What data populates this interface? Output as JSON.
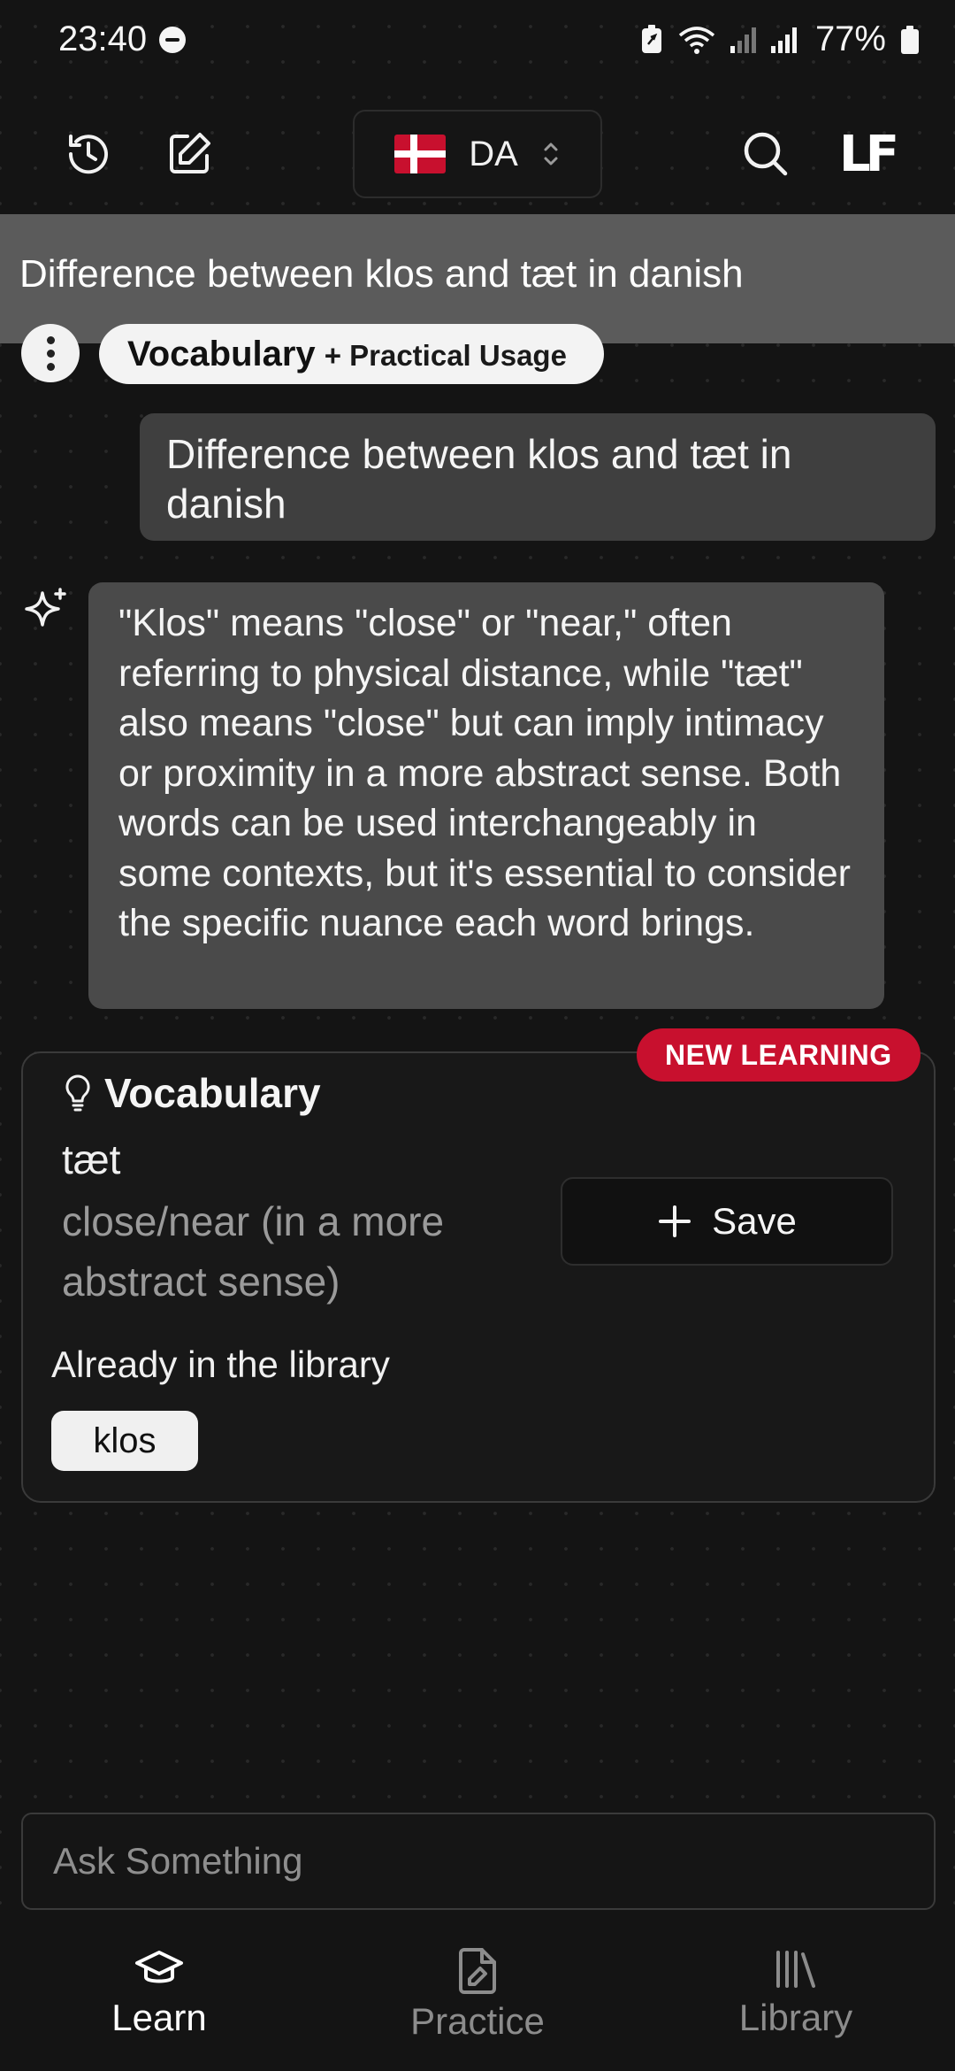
{
  "status_bar": {
    "time": "23:40",
    "battery_percent": "77%"
  },
  "top_bar": {
    "language_code": "DA",
    "logo_text": "LF",
    "icons": [
      "history-icon",
      "edit-icon",
      "search-icon"
    ]
  },
  "banner": {
    "text": "Difference between klos and tæt in danish"
  },
  "chip": {
    "main": "Vocabulary",
    "sub": "+ Practical Usage"
  },
  "conversation": {
    "user_message": "Difference between klos and tæt in danish",
    "ai_message": "\"Klos\" means \"close\" or \"near,\" often referring to physical distance, while \"tæt\" also means \"close\" but can imply intimacy or proximity in a more abstract sense. Both words can be used interchangeably in some contexts, but it's essential to consider the specific nuance each word brings."
  },
  "vocab_card": {
    "badge": "NEW LEARNING",
    "title": "Vocabulary",
    "word": "tæt",
    "meaning": "close/near (in a more abstract sense)",
    "save_label": "Save",
    "library_label": "Already in the library",
    "library_words": [
      "klos"
    ]
  },
  "input": {
    "placeholder": "Ask Something"
  },
  "bottom_nav": {
    "items": [
      {
        "label": "Learn",
        "active": true
      },
      {
        "label": "Practice",
        "active": false
      },
      {
        "label": "Library",
        "active": false
      }
    ]
  },
  "colors": {
    "accent_red": "#c8102e",
    "banner_grey": "#5b5b5b",
    "ai_bubble": "#4a4a4a",
    "user_bubble": "#3f3f3f"
  }
}
